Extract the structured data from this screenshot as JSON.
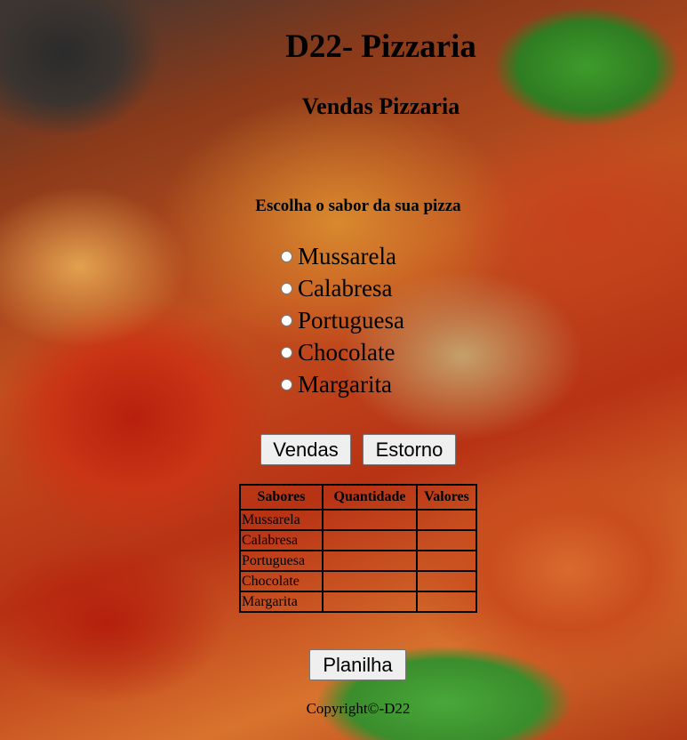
{
  "header": {
    "title": "D22- Pizzaria",
    "subtitle": "Vendas Pizzaria"
  },
  "form": {
    "prompt": "Escolha o sabor da sua pizza",
    "flavors": [
      "Mussarela",
      "Calabresa",
      "Portuguesa",
      "Chocolate",
      "Margarita"
    ],
    "buttons": {
      "sales": "Vendas",
      "refund": "Estorno",
      "spreadsheet": "Planilha"
    }
  },
  "table": {
    "headers": [
      "Sabores",
      "Quantidade",
      "Valores"
    ],
    "rows": [
      [
        "Mussarela",
        "",
        ""
      ],
      [
        "Calabresa",
        "",
        ""
      ],
      [
        "Portuguesa",
        "",
        ""
      ],
      [
        "Chocolate",
        "",
        ""
      ],
      [
        "Margarita",
        "",
        ""
      ]
    ]
  },
  "footer": {
    "copyright": "Copyright©-D22"
  }
}
